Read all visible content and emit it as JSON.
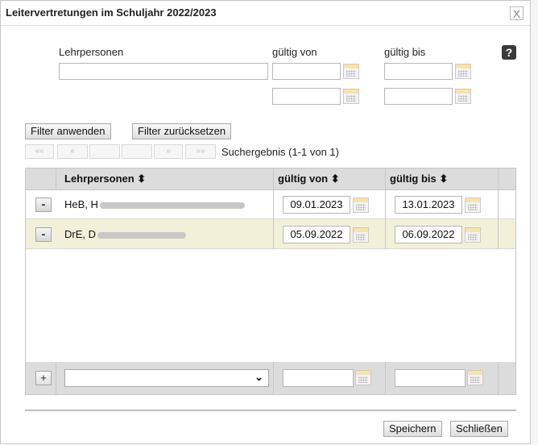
{
  "dialog": {
    "title": "Leitervertretungen im Schuljahr 2022/2023",
    "close_glyph": "X",
    "help_glyph": "?"
  },
  "filter": {
    "label_persons": "Lehrpersonen",
    "label_from": "gültig von",
    "label_to": "gültig bis",
    "persons_value": "",
    "from_value_1": "",
    "to_value_1": "",
    "from_value_2": "",
    "to_value_2": "",
    "apply_label": "Filter anwenden",
    "reset_label": "Filter zurücksetzen"
  },
  "pager": {
    "first": "««",
    "prev": "«",
    "next": "»",
    "last": "»»",
    "result_text": "Suchergebnis (1-1 von 1)"
  },
  "grid": {
    "columns": [
      "Lehrpersonen ⬍",
      "gültig von ⬍",
      "gültig bis ⬍"
    ],
    "rows": [
      {
        "name": "HeB, H",
        "from": "09.01.2023",
        "to": "13.01.2023"
      },
      {
        "name": "DrE, D",
        "from": "05.09.2022",
        "to": "06.09.2022"
      }
    ],
    "add_row": {
      "select_value": "",
      "from": "",
      "to": ""
    },
    "minus_glyph": "-",
    "plus_glyph": "+",
    "chevron_glyph": "⌄"
  },
  "footer": {
    "save_label": "Speichern",
    "close_label": "Schließen"
  },
  "colors": {
    "header_bg": "#dcdcdc",
    "alt_row_bg": "#f3f0da",
    "accent_arrow": "#ee2222"
  }
}
